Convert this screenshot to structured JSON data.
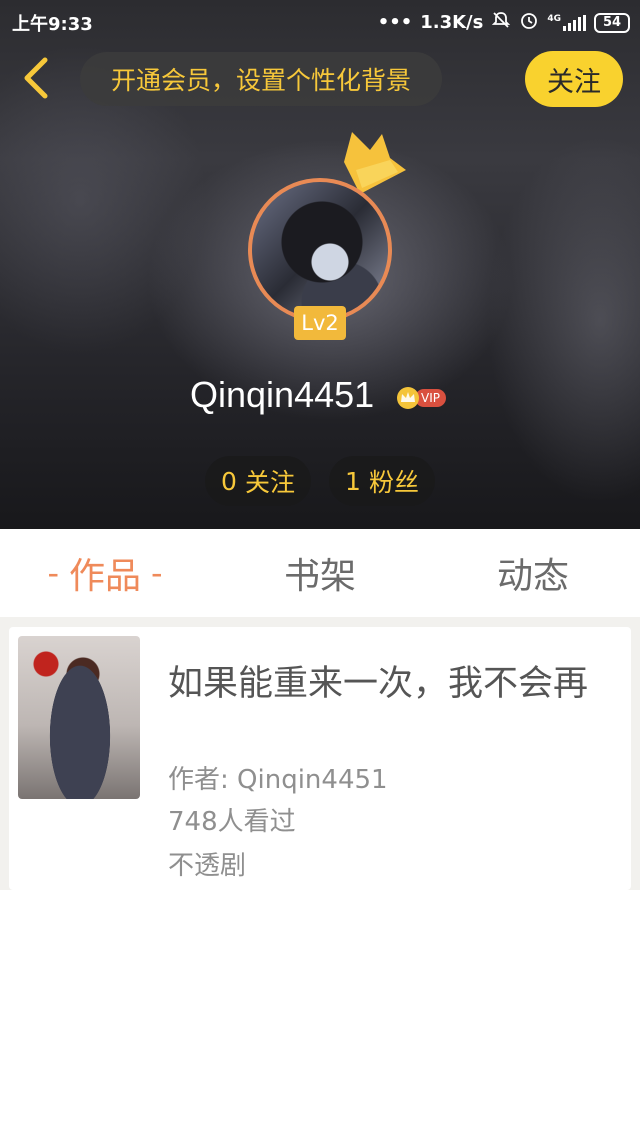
{
  "status_bar": {
    "time": "上午9:33",
    "network_speed": "1.3K/s",
    "network_type": "4G",
    "battery": "54",
    "icons": [
      "dots-icon",
      "mute-bell-icon",
      "alarm-icon",
      "signal-icon",
      "battery-icon"
    ]
  },
  "header": {
    "back_icon": "chevron-left-icon",
    "promo_text": "开通会员，设置个性化背景",
    "follow_label": "关注",
    "level": "Lv2",
    "username": "Qinqin4451",
    "vip_label": "VIP",
    "following": {
      "count": "0",
      "label": "关注"
    },
    "fans": {
      "count": "1",
      "label": "粉丝"
    }
  },
  "tabs": [
    {
      "label": "作品",
      "active": true
    },
    {
      "label": "书架",
      "active": false
    },
    {
      "label": "动态",
      "active": false
    }
  ],
  "tab_dash": "-",
  "works": [
    {
      "title": "如果能重来一次，我不会再",
      "author": "作者: Qinqin4451",
      "views": "748人看过",
      "tag": "不透剧"
    }
  ],
  "colors": {
    "accent_yellow": "#f9d22e",
    "accent_orange": "#ef8a5a",
    "vip_red": "#d9503f",
    "level_gold": "#f2b93b"
  }
}
